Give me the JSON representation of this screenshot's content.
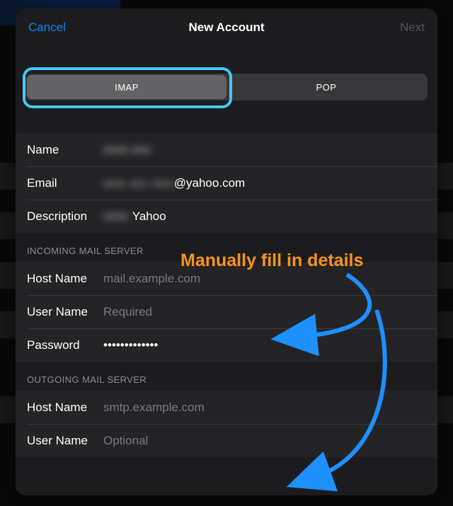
{
  "header": {
    "cancel": "Cancel",
    "title": "New Account",
    "next": "Next"
  },
  "segmented": {
    "imap": "IMAP",
    "pop": "POP",
    "selected": "IMAP"
  },
  "account": {
    "name_label": "Name",
    "name_value": "",
    "email_label": "Email",
    "email_suffix": "@yahoo.com",
    "description_label": "Description",
    "description_visible": "Yahoo"
  },
  "incoming": {
    "header": "Incoming Mail Server",
    "hostname_label": "Host Name",
    "hostname_placeholder": "mail.example.com",
    "username_label": "User Name",
    "username_placeholder": "Required",
    "password_label": "Password",
    "password_value": "•••••••••••••"
  },
  "outgoing": {
    "header": "Outgoing Mail Server",
    "hostname_label": "Host Name",
    "hostname_placeholder": "smtp.example.com",
    "username_label": "User Name",
    "username_placeholder": "Optional"
  },
  "annotation": {
    "text": "Manually fill in details"
  }
}
